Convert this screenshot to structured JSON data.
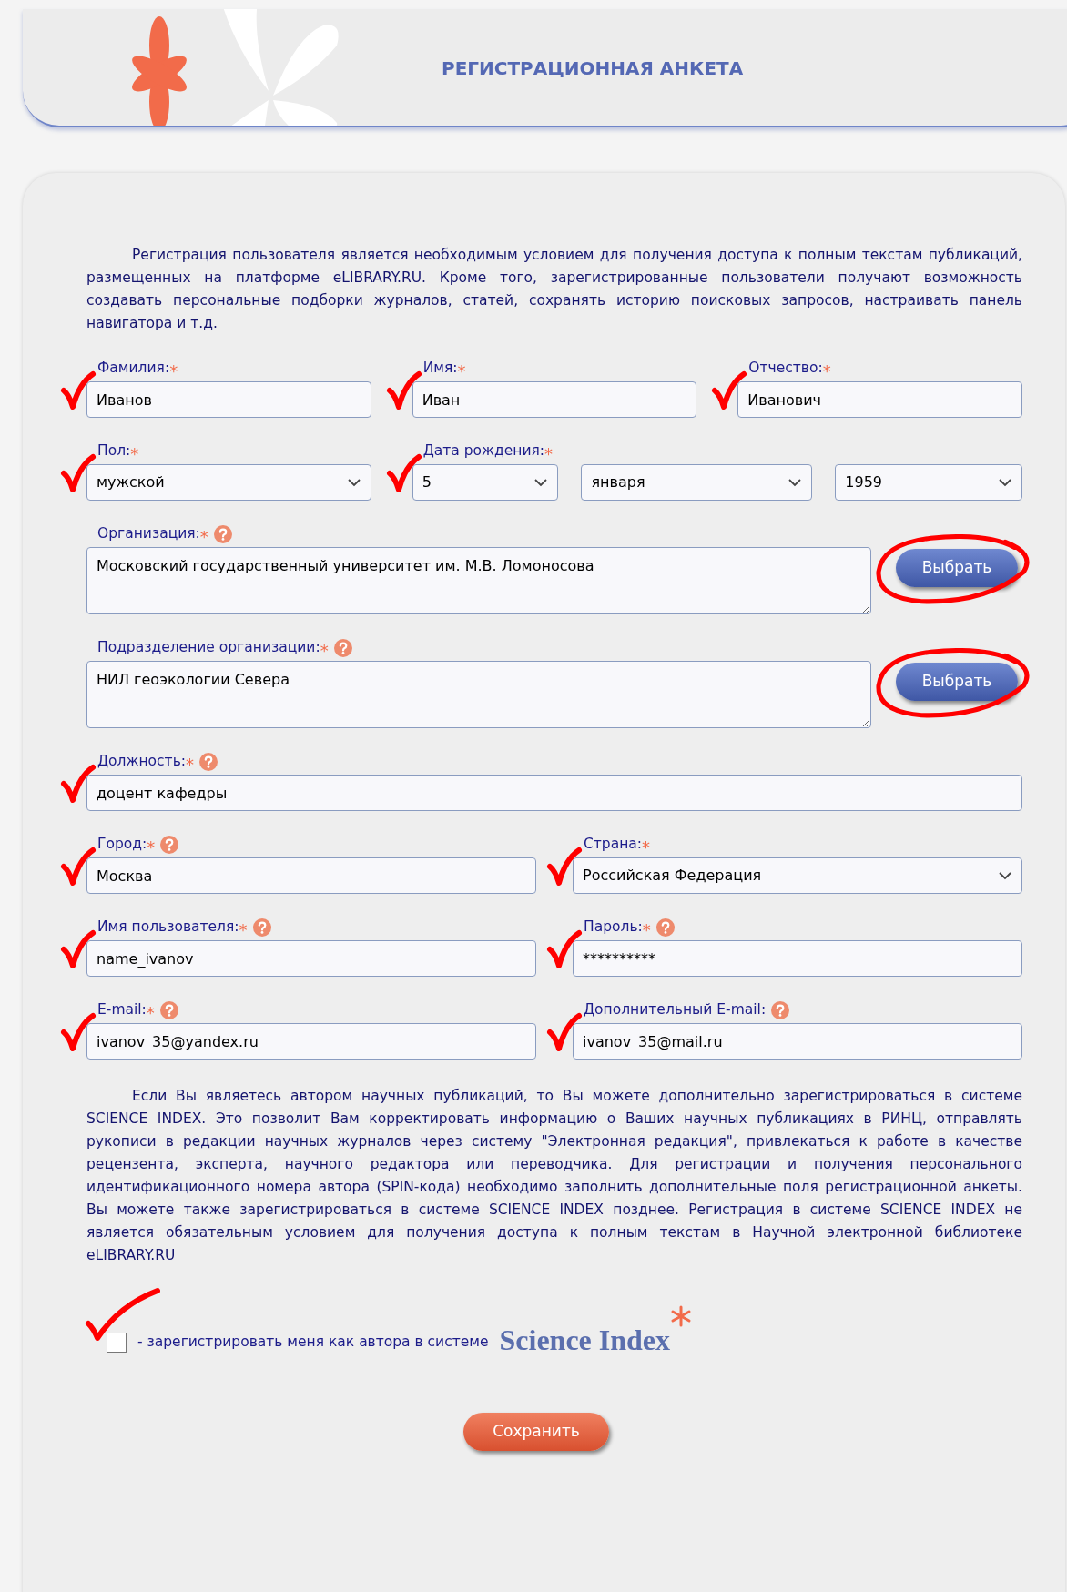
{
  "header": {
    "title": "РЕГИСТРАЦИОННАЯ АНКЕТА"
  },
  "intro": "Регистрация пользователя является необходимым условием для получения доступа к полным текстам публикаций, размещенных на платформе eLIBRARY.RU. Кроме того, зарегистрированные пользователи получают возможность создавать персональные подборки журналов, статей, сохранять историю поисковых запросов, настраивать панель навигатора и т.д.",
  "rows": [
    [
      {
        "kind": "text",
        "label": "Фамилия:",
        "asterisk": "*",
        "help": false,
        "value": "Иванов",
        "ticked": true
      },
      {
        "kind": "text",
        "label": "Имя:",
        "asterisk": "*",
        "help": false,
        "value": "Иван",
        "ticked": true
      },
      {
        "kind": "text",
        "label": "Отчество:",
        "asterisk": "*",
        "help": false,
        "value": "Иванович",
        "ticked": true
      }
    ],
    [
      {
        "kind": "select",
        "label": "Пол:",
        "asterisk": "*",
        "help": false,
        "value": "мужской",
        "ticked": true
      },
      {
        "kind": "date",
        "label": "Дата рождения:",
        "asterisk": "*",
        "help": false,
        "ticked": true,
        "parts": [
          {
            "value": "5"
          },
          {
            "value": "января"
          },
          {
            "value": "1959"
          }
        ]
      }
    ],
    [
      {
        "kind": "textarea",
        "label": "Организация:",
        "asterisk": "*",
        "help": true,
        "value": "Московский государственный университет им. М.В. Ломоносова",
        "ticked": false,
        "button": {
          "label": "Выбрать",
          "circled": true
        }
      }
    ],
    [
      {
        "kind": "textarea",
        "label": "Подразделение организации:",
        "asterisk": "*",
        "help": true,
        "value": "НИЛ геоэкологии Севера",
        "ticked": false,
        "button": {
          "label": "Выбрать",
          "circled": true
        }
      }
    ],
    [
      {
        "kind": "text",
        "label": "Должность:",
        "asterisk": "*",
        "help": true,
        "value": "доцент кафедры",
        "ticked": true
      }
    ],
    [
      {
        "kind": "text",
        "label": "Город:",
        "asterisk": "*",
        "help": true,
        "value": "Москва",
        "ticked": true
      },
      {
        "kind": "select",
        "label": "Страна:",
        "asterisk": "*",
        "help": false,
        "value": "Российская Федерация",
        "ticked": true
      }
    ],
    [
      {
        "kind": "text",
        "label": "Имя пользователя:",
        "asterisk": "*",
        "help": true,
        "value": "name_ivanov",
        "ticked": true
      },
      {
        "kind": "text",
        "label": "Пароль:",
        "asterisk": "*",
        "help": true,
        "value": "**********",
        "ticked": true
      }
    ],
    [
      {
        "kind": "text",
        "label": "E-mail:",
        "asterisk": "*",
        "help": true,
        "value": "ivanov_35@yandex.ru",
        "ticked": true
      },
      {
        "kind": "text",
        "label": "Дополнительный E-mail:",
        "help": true,
        "value": "ivanov_35@mail.ru",
        "ticked": true
      }
    ]
  ],
  "science_note": "Если Вы являетесь автором научных публикаций, то Вы можете дополнительно зарегистрироваться в системе SCIENCE INDEX. Это позволит Вам корректировать информацию о Ваших научных публикациях в РИНЦ, отправлять рукописи в редакции научных журналов через систему \"Электронная редакция\", привлекаться к работе в качестве рецензента, эксперта, научного редактора или переводчика. Для регистрации и получения персонального идентификационного номера автора (SPIN-кода) необходимо заполнить дополнительные поля регистрационной анкеты. Вы можете также зарегистрироваться в системе SCIENCE INDEX позднее. Регистрация в системе SCIENCE INDEX не является обязательным условием для получения доступа к полным текстам в Научной электронной библиотеке eLIBRARY.RU",
  "author_option": {
    "checked": false,
    "ticked": true,
    "label": "- зарегистрировать меня как автора в системе",
    "brand": "Science Index"
  },
  "save_button": {
    "label": "Сохранить"
  }
}
